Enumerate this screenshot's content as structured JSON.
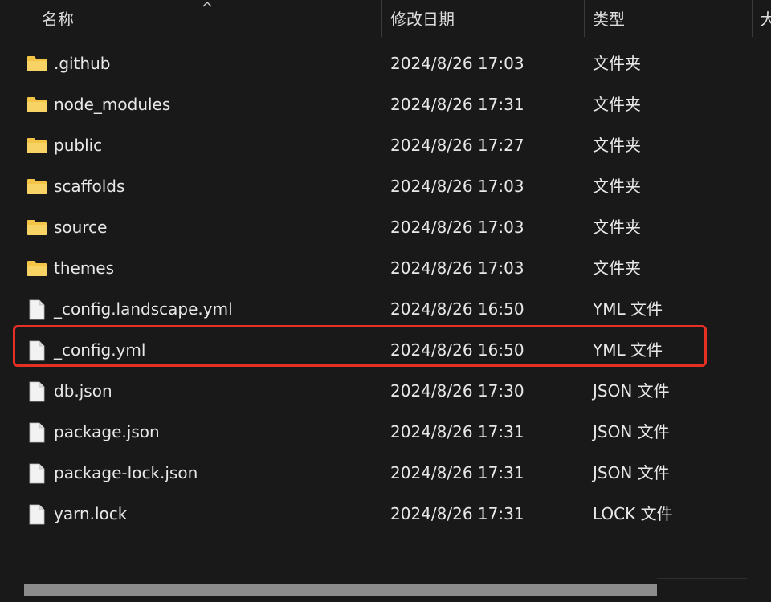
{
  "header": {
    "name": "名称",
    "date": "修改日期",
    "type": "类型",
    "size_partial": "大"
  },
  "icons": {
    "folder": "folder-icon",
    "file": "file-icon",
    "folder_color": "#f4c447",
    "file_color": "#f2f2f2"
  },
  "accent": {
    "highlight_border": "#e53024"
  },
  "files": [
    {
      "name": ".github",
      "date": "2024/8/26 17:03",
      "type": "文件夹",
      "kind": "folder"
    },
    {
      "name": "node_modules",
      "date": "2024/8/26 17:31",
      "type": "文件夹",
      "kind": "folder"
    },
    {
      "name": "public",
      "date": "2024/8/26 17:27",
      "type": "文件夹",
      "kind": "folder"
    },
    {
      "name": "scaffolds",
      "date": "2024/8/26 17:03",
      "type": "文件夹",
      "kind": "folder"
    },
    {
      "name": "source",
      "date": "2024/8/26 17:03",
      "type": "文件夹",
      "kind": "folder"
    },
    {
      "name": "themes",
      "date": "2024/8/26 17:03",
      "type": "文件夹",
      "kind": "folder"
    },
    {
      "name": "_config.landscape.yml",
      "date": "2024/8/26 16:50",
      "type": "YML 文件",
      "kind": "file"
    },
    {
      "name": "_config.yml",
      "date": "2024/8/26 16:50",
      "type": "YML 文件",
      "kind": "file"
    },
    {
      "name": "db.json",
      "date": "2024/8/26 17:30",
      "type": "JSON 文件",
      "kind": "file"
    },
    {
      "name": "package.json",
      "date": "2024/8/26 17:31",
      "type": "JSON 文件",
      "kind": "file"
    },
    {
      "name": "package-lock.json",
      "date": "2024/8/26 17:31",
      "type": "JSON 文件",
      "kind": "file"
    },
    {
      "name": "yarn.lock",
      "date": "2024/8/26 17:31",
      "type": "LOCK 文件",
      "kind": "file"
    }
  ]
}
